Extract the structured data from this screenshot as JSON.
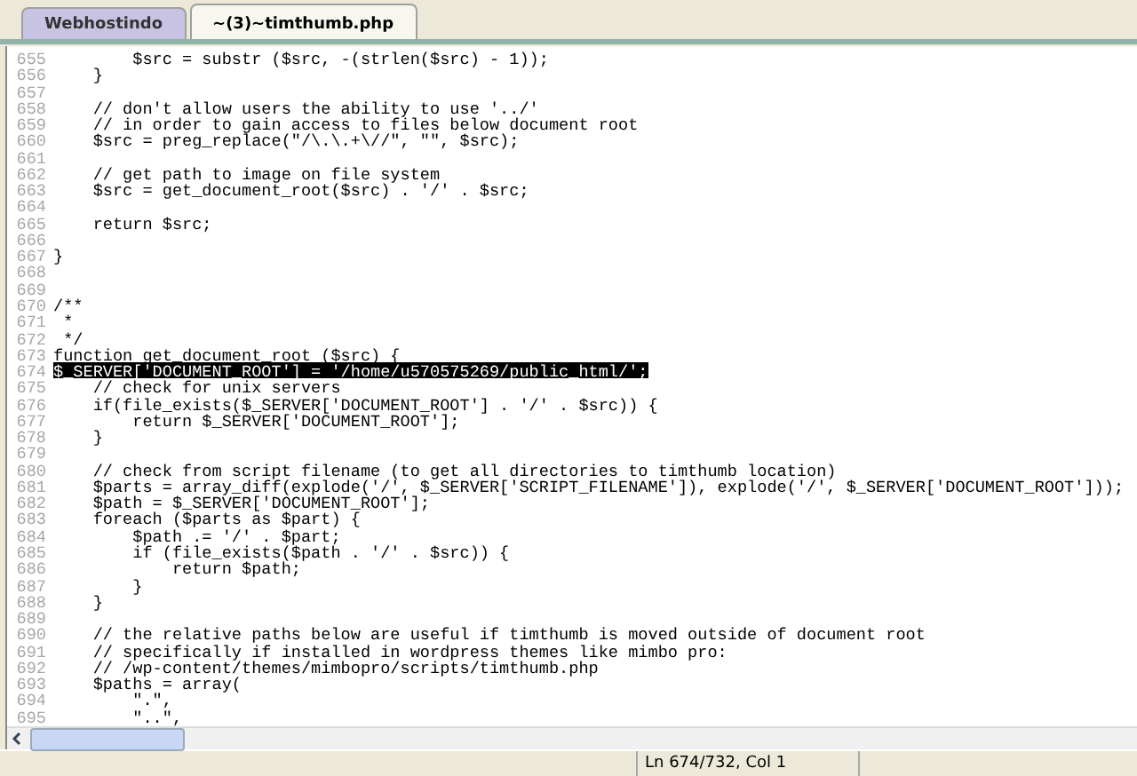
{
  "tabs": [
    {
      "label": "Webhostindo",
      "selected": false
    },
    {
      "label": "~(3)~timthumb.php",
      "selected": true
    }
  ],
  "editor": {
    "lines": [
      {
        "number": "655",
        "text": "        $src = substr ($src, -(strlen($src) - 1));",
        "selected": false
      },
      {
        "number": "656",
        "text": "    }",
        "selected": false
      },
      {
        "number": "657",
        "selected": false
      },
      {
        "number": "658",
        "text": "    // don't allow users the ability to use '../'",
        "selected": false
      },
      {
        "number": "659",
        "text": "    // in order to gain access to files below document root",
        "selected": false
      },
      {
        "number": "660",
        "text": "    $src = preg_replace(\"/\\.\\.+\\//\", \"\", $src);",
        "selected": false
      },
      {
        "number": "661",
        "selected": false
      },
      {
        "number": "662",
        "text": "    // get path to image on file system",
        "selected": false
      },
      {
        "number": "663",
        "text": "    $src = get_document_root($src) . '/' . $src;",
        "selected": false
      },
      {
        "number": "664",
        "selected": false
      },
      {
        "number": "665",
        "text": "    return $src;",
        "selected": false
      },
      {
        "number": "666",
        "selected": false
      },
      {
        "number": "667",
        "text": "}",
        "selected": false
      },
      {
        "number": "668",
        "selected": false
      },
      {
        "number": "669",
        "selected": false
      },
      {
        "number": "670",
        "text": "/**",
        "selected": false
      },
      {
        "number": "671",
        "text": " *",
        "selected": false
      },
      {
        "number": "672",
        "text": " */",
        "selected": false
      },
      {
        "number": "673",
        "text": "function get_document_root ($src) {",
        "selected": false
      },
      {
        "number": "674",
        "text": "$_SERVER['DOCUMENT_ROOT'] = '/home/u570575269/public_html/';",
        "selected": true
      },
      {
        "number": "675",
        "text": "    // check for unix servers",
        "selected": false
      },
      {
        "number": "676",
        "text": "    if(file_exists($_SERVER['DOCUMENT_ROOT'] . '/' . $src)) {",
        "selected": false
      },
      {
        "number": "677",
        "text": "        return $_SERVER['DOCUMENT_ROOT'];",
        "selected": false
      },
      {
        "number": "678",
        "text": "    }",
        "selected": false
      },
      {
        "number": "679",
        "selected": false
      },
      {
        "number": "680",
        "text": "    // check from script filename (to get all directories to timthumb location)",
        "selected": false
      },
      {
        "number": "681",
        "text": "    $parts = array_diff(explode('/', $_SERVER['SCRIPT_FILENAME']), explode('/', $_SERVER['DOCUMENT_ROOT']));",
        "selected": false
      },
      {
        "number": "682",
        "text": "    $path = $_SERVER['DOCUMENT_ROOT'];",
        "selected": false
      },
      {
        "number": "683",
        "text": "    foreach ($parts as $part) {",
        "selected": false
      },
      {
        "number": "684",
        "text": "        $path .= '/' . $part;",
        "selected": false
      },
      {
        "number": "685",
        "text": "        if (file_exists($path . '/' . $src)) {",
        "selected": false
      },
      {
        "number": "686",
        "text": "            return $path;",
        "selected": false
      },
      {
        "number": "687",
        "text": "        }",
        "selected": false
      },
      {
        "number": "688",
        "text": "    }",
        "selected": false
      },
      {
        "number": "689",
        "selected": false
      },
      {
        "number": "690",
        "text": "    // the relative paths below are useful if timthumb is moved outside of document root",
        "selected": false
      },
      {
        "number": "691",
        "text": "    // specifically if installed in wordpress themes like mimbo pro:",
        "selected": false
      },
      {
        "number": "692",
        "text": "    // /wp-content/themes/mimbopro/scripts/timthumb.php",
        "selected": false
      },
      {
        "number": "693",
        "text": "    $paths = array(",
        "selected": false
      },
      {
        "number": "694",
        "text": "        \".\",",
        "selected": false
      },
      {
        "number": "695",
        "text": "        \"..\",",
        "selected": false
      }
    ]
  },
  "status_bar": {
    "position": "Ln 674/732, Col 1"
  }
}
